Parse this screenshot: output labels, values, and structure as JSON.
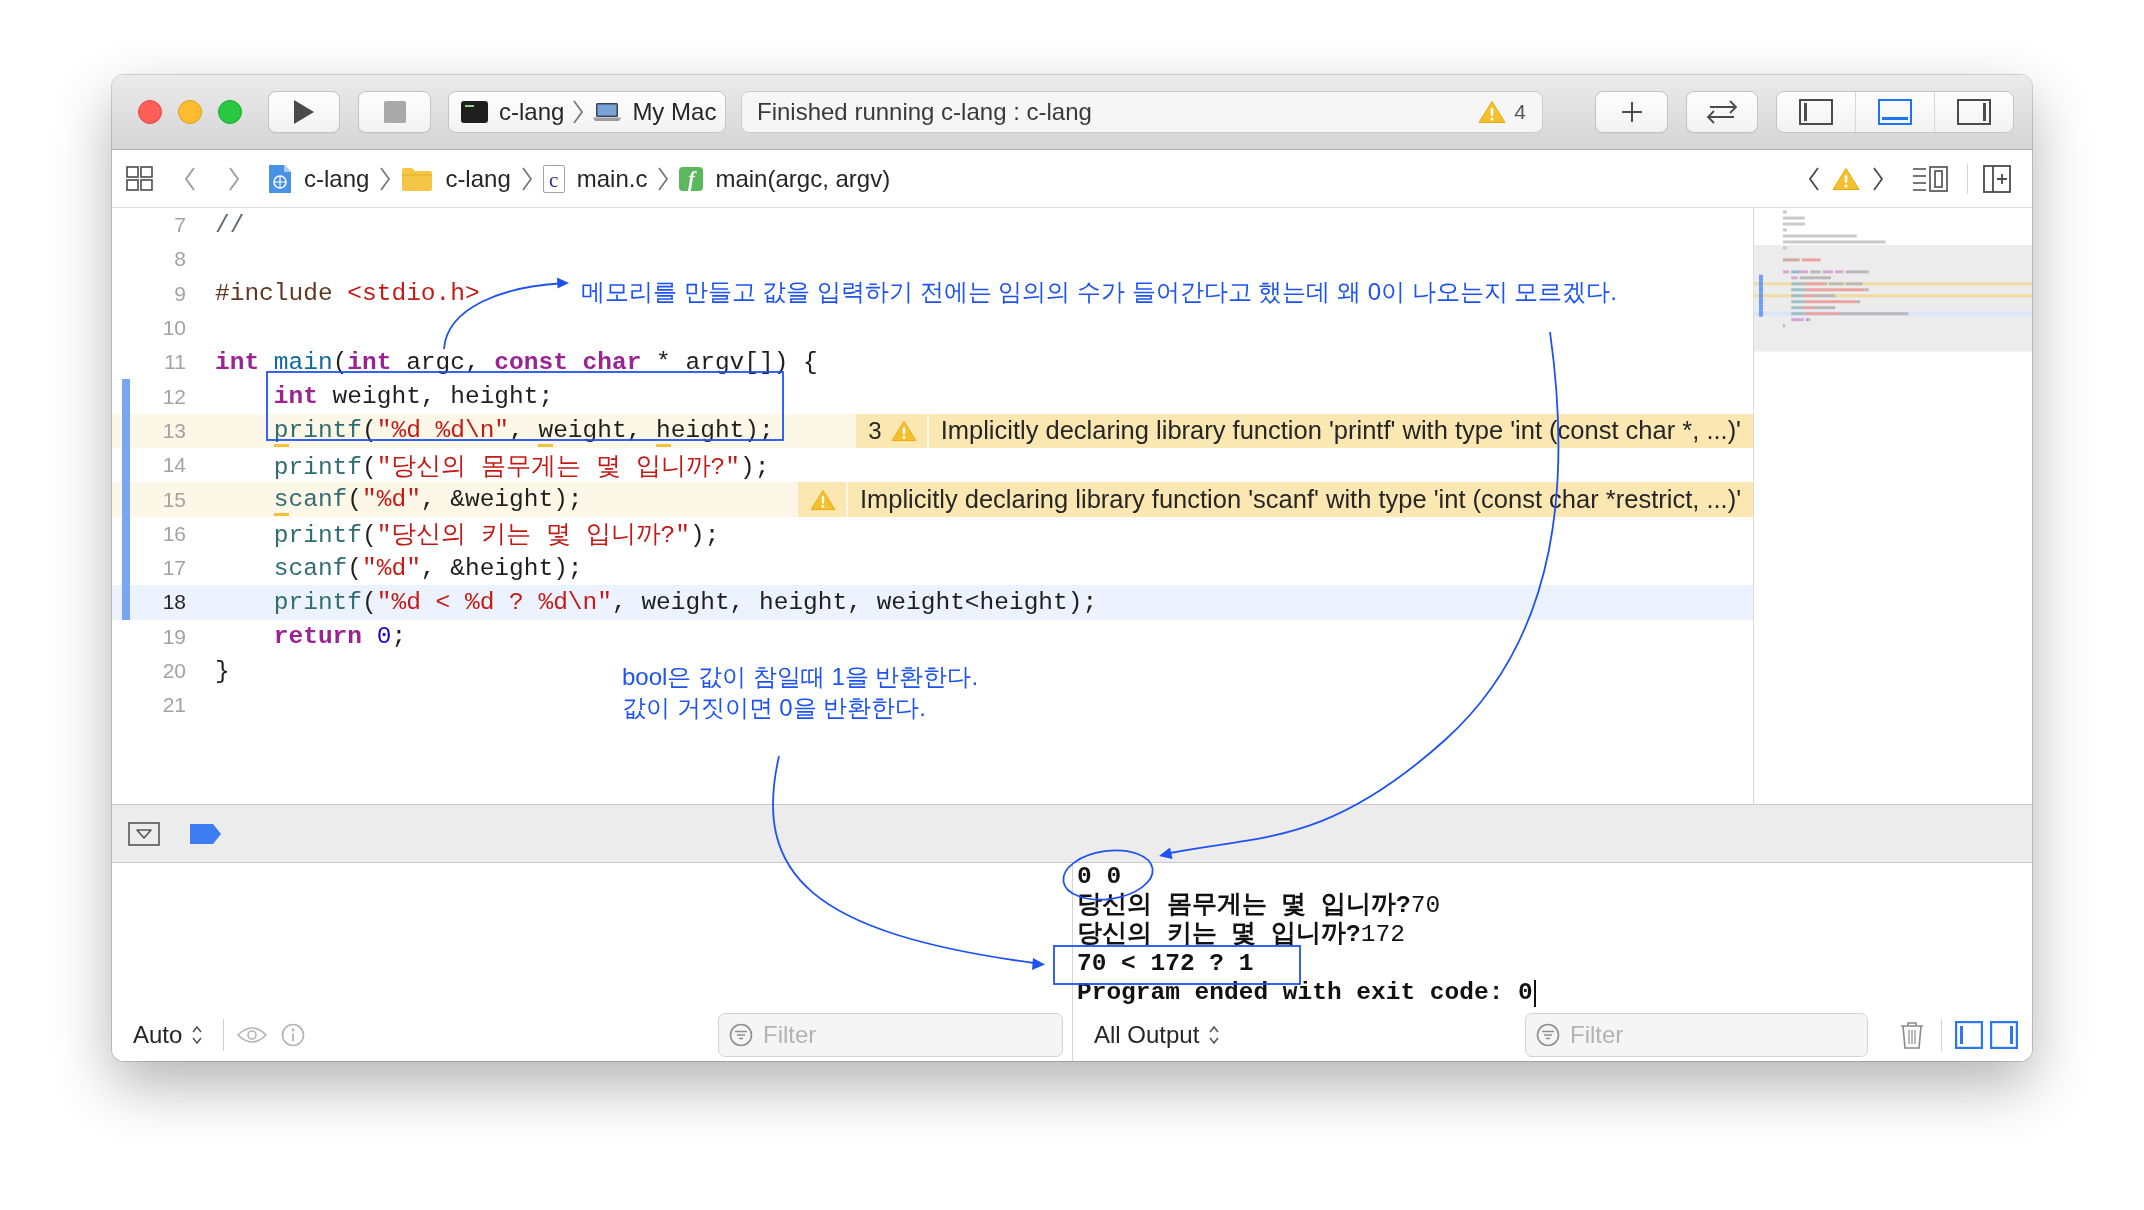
{
  "toolbar": {
    "run_controls": [
      {
        "kind": "run",
        "disabled": false
      },
      {
        "kind": "stop",
        "disabled": true
      }
    ],
    "scheme": "c-lang",
    "destination": "My Mac",
    "status": "Finished running c-lang : c-lang",
    "warning_count": "4",
    "panel_toggles": [
      {
        "kind": "navigator",
        "selected": false
      },
      {
        "kind": "debug_area",
        "selected": true
      },
      {
        "kind": "inspector",
        "selected": false
      }
    ]
  },
  "jump_bar": {
    "path": [
      {
        "kind": "project",
        "label": "c-lang"
      },
      {
        "kind": "folder",
        "label": "c-lang"
      },
      {
        "kind": "file",
        "icon_glyph": "c",
        "label": "main.c"
      },
      {
        "kind": "function",
        "icon_glyph": "f",
        "label": "main(argc, argv)"
      }
    ]
  },
  "editor": {
    "lines": [
      {
        "number": "7",
        "changed": false,
        "current": false,
        "tokens": [
          {
            "kind": "comment",
            "text": "//"
          }
        ]
      },
      {
        "number": "8",
        "changed": false,
        "current": false
      },
      {
        "number": "9",
        "changed": false,
        "current": false,
        "tokens": [
          {
            "kind": "preprocessor",
            "text": "#include "
          },
          {
            "kind": "string",
            "text": "<stdio.h>"
          }
        ]
      },
      {
        "number": "10",
        "changed": false,
        "current": false
      },
      {
        "number": "11",
        "changed": false,
        "current": false,
        "tokens": [
          {
            "kind": "keyword",
            "text": "int "
          },
          {
            "kind": "declaration",
            "text": "main"
          },
          {
            "kind": "plain",
            "text": "("
          },
          {
            "kind": "keyword",
            "text": "int"
          },
          {
            "kind": "plain",
            "text": " argc, "
          },
          {
            "kind": "keyword",
            "text": "const "
          },
          {
            "kind": "keyword",
            "text": "char"
          },
          {
            "kind": "plain",
            "text": " * argv[]) {"
          }
        ]
      },
      {
        "number": "12",
        "changed": true,
        "current": false,
        "tokens": [
          {
            "kind": "keyword",
            "text": "    int"
          },
          {
            "kind": "plain",
            "text": " weight, height;"
          }
        ]
      },
      {
        "number": "13",
        "changed": true,
        "current": false,
        "tokens": [
          {
            "kind": "function",
            "text": "    printf",
            "warning_underline": true
          },
          {
            "kind": "plain",
            "text": "("
          },
          {
            "kind": "string",
            "text": "\"%d %d\\n\""
          },
          {
            "kind": "plain",
            "text": ", "
          },
          {
            "kind": "plain",
            "text": "weight",
            "warning_underline": true
          },
          {
            "kind": "plain",
            "text": ", "
          },
          {
            "kind": "plain",
            "text": "height",
            "warning_underline": true
          },
          {
            "kind": "plain",
            "text": ");"
          }
        ],
        "issue": {
          "count": "3",
          "message": "Implicitly declaring library function 'printf' with type 'int (const char *, ...)'"
        }
      },
      {
        "number": "14",
        "changed": true,
        "current": false,
        "tokens": [
          {
            "kind": "function",
            "text": "    printf"
          },
          {
            "kind": "plain",
            "text": "("
          },
          {
            "kind": "string",
            "text": "\"당신의 몸무게는 몇 입니까?\""
          },
          {
            "kind": "plain",
            "text": ");"
          }
        ]
      },
      {
        "number": "15",
        "changed": true,
        "current": false,
        "tokens": [
          {
            "kind": "function",
            "text": "    scanf",
            "warning_underline": true
          },
          {
            "kind": "plain",
            "text": "("
          },
          {
            "kind": "string",
            "text": "\"%d\""
          },
          {
            "kind": "plain",
            "text": ", &weight);"
          }
        ],
        "issue": {
          "message": "Implicitly declaring library function 'scanf' with type 'int (const char *restrict, ...)'"
        }
      },
      {
        "number": "16",
        "changed": true,
        "current": false,
        "tokens": [
          {
            "kind": "function",
            "text": "    printf"
          },
          {
            "kind": "plain",
            "text": "("
          },
          {
            "kind": "string",
            "text": "\"당신의 키는 몇 입니까?\""
          },
          {
            "kind": "plain",
            "text": ");"
          }
        ]
      },
      {
        "number": "17",
        "changed": true,
        "current": false,
        "tokens": [
          {
            "kind": "function",
            "text": "    scanf"
          },
          {
            "kind": "plain",
            "text": "("
          },
          {
            "kind": "string",
            "text": "\"%d\""
          },
          {
            "kind": "plain",
            "text": ", &height);"
          }
        ]
      },
      {
        "number": "18",
        "changed": true,
        "current": true,
        "tokens": [
          {
            "kind": "function",
            "text": "    printf"
          },
          {
            "kind": "plain",
            "text": "("
          },
          {
            "kind": "string",
            "text": "\"%d < %d ? %d\\n\""
          },
          {
            "kind": "plain",
            "text": ", weight, height, weight<height);"
          }
        ]
      },
      {
        "number": "19",
        "changed": false,
        "current": false,
        "tokens": [
          {
            "kind": "keyword",
            "text": "    return "
          },
          {
            "kind": "number",
            "text": "0"
          },
          {
            "kind": "plain",
            "text": ";"
          }
        ]
      },
      {
        "number": "20",
        "changed": false,
        "current": false,
        "tokens": [
          {
            "kind": "plain",
            "text": "}"
          }
        ]
      },
      {
        "number": "21",
        "changed": false,
        "current": false
      }
    ]
  },
  "annotations": {
    "notes": [
      "메모리를 만들고 값을 입력하기 전에는 임의의 수가 들어간다고 했는데 왜 0이 나오는지 모르겠다.",
      "bool은 값이 참일때 1을 반환한다.",
      "값이 거짓이면 0을 반환한다."
    ]
  },
  "debug_bar": {
    "breakpoints_active": true
  },
  "variables_view": {
    "scope": "Auto",
    "filter": {
      "placeholder": "Filter"
    }
  },
  "console": {
    "lines": [
      {
        "output": "0 0",
        "cursor": false
      },
      {
        "output": "당신의 몸무게는 몇 입니까?",
        "input": "70",
        "cursor": false
      },
      {
        "output": "당신의 키는 몇 입니까?",
        "input": "172",
        "cursor": false
      },
      {
        "output": "70 < 172 ? 1",
        "cursor": false
      },
      {
        "output": "Program ended with exit code: 0",
        "cursor": true
      }
    ],
    "output_mode": "All Output",
    "filter": {
      "placeholder": "Filter"
    },
    "panes": [
      {
        "kind": "variables",
        "selected": true
      },
      {
        "kind": "console",
        "selected": true
      }
    ]
  }
}
